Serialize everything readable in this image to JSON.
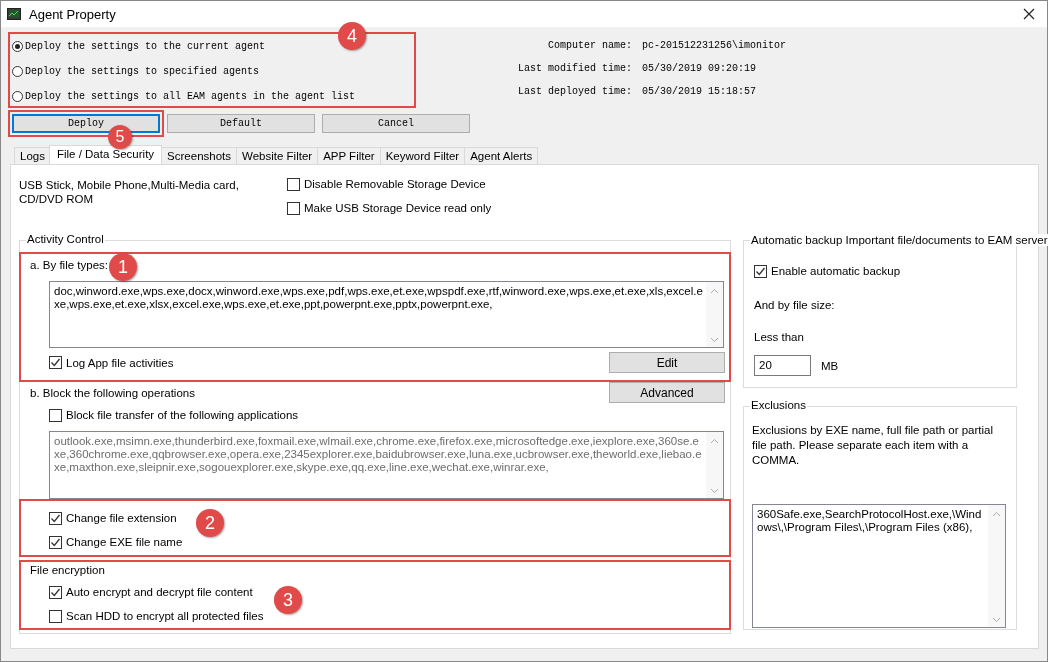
{
  "window": {
    "title": "Agent Property"
  },
  "deploy_targets": {
    "annotation": "4",
    "options": [
      {
        "label": "Deploy the settings to the current agent",
        "selected": true
      },
      {
        "label": "Deploy the settings to specified agents",
        "selected": false
      },
      {
        "label": "Deploy the settings to all EAM agents in the agent list",
        "selected": false
      }
    ]
  },
  "info": [
    {
      "label": "Computer name:",
      "value": "pc-201512231256\\imonitor"
    },
    {
      "label": "Last modified time:",
      "value": "05/30/2019 09:20:19"
    },
    {
      "label": "Last deployed time:",
      "value": "05/30/2019 15:18:57"
    }
  ],
  "buttons": [
    {
      "label": "Deploy",
      "focused": true,
      "annotation": "5"
    },
    {
      "label": "Default",
      "focused": false
    },
    {
      "label": "Cancel",
      "focused": false
    }
  ],
  "tabs": [
    {
      "label": "Logs",
      "selected": false
    },
    {
      "label": "File / Data Security",
      "selected": true
    },
    {
      "label": "Screenshots",
      "selected": false
    },
    {
      "label": "Website Filter",
      "selected": false
    },
    {
      "label": "APP Filter",
      "selected": false
    },
    {
      "label": "Keyword Filter",
      "selected": false
    },
    {
      "label": "Agent Alerts",
      "selected": false
    }
  ],
  "devices": {
    "text": "USB Stick, Mobile Phone,Multi-Media card, CD/DVD ROM",
    "options": [
      {
        "label": "Disable Removable Storage Device",
        "checked": false
      },
      {
        "label": "Make USB Storage Device read only",
        "checked": false
      }
    ]
  },
  "activity_control": {
    "title": "Activity Control",
    "by_file_types": {
      "annotation": "1",
      "label": "a. By file types:",
      "text": "doc,winword.exe,wps.exe,docx,winword.exe,wps.exe,pdf,wps.exe,et.exe,wpspdf.exe,rtf,winword.exe,wps.exe,et.exe,xls,excel.exe,wps.exe,et.exe,xlsx,excel.exe,wps.exe,et.exe,ppt,powerpnt.exe,pptx,powerpnt.exe,",
      "log_option": {
        "label": "Log App file activities",
        "checked": true
      },
      "edit_button": "Edit"
    },
    "block": {
      "label": "b. Block the following operations",
      "advanced_button": "Advanced",
      "option": {
        "label": "Block file transfer of the following applications",
        "checked": false
      },
      "text": "outlook.exe,msimn.exe,thunderbird.exe,foxmail.exe,wlmail.exe,chrome.exe,firefox.exe,microsoftedge.exe,iexplore.exe,360se.exe,360chrome.exe,qqbrowser.exe,opera.exe,2345explorer.exe,baidubrowser.exe,luna.exe,ucbrowser.exe,theworld.exe,liebao.exe,maxthon.exe,sleipnir.exe,sogouexplorer.exe,skype.exe,qq.exe,line.exe,wechat.exe,winrar.exe,"
    },
    "changes": {
      "annotation": "2",
      "options": [
        {
          "label": "Change file extension",
          "checked": true
        },
        {
          "label": "Change EXE file name",
          "checked": true
        }
      ]
    },
    "encryption": {
      "annotation": "3",
      "title": "File encryption",
      "options": [
        {
          "label": "Auto encrypt and decrypt file content",
          "checked": true
        },
        {
          "label": "Scan HDD to encrypt all protected files",
          "checked": false
        }
      ]
    }
  },
  "backup": {
    "title": "Automatic backup Important file/documents to EAM server",
    "option": {
      "label": "Enable automatic backup",
      "checked": true
    },
    "size_label": "And by file size:",
    "less_than": "Less than",
    "size_value": "20",
    "unit": "MB"
  },
  "exclusions": {
    "title": "Exclusions",
    "description": "Exclusions by EXE name, full file path or partial file path. Please separate each item with a COMMA.",
    "text": "360Safe.exe,SearchProtocolHost.exe,\\Windows\\,\\Program Files\\,\\Program Files (x86),"
  }
}
